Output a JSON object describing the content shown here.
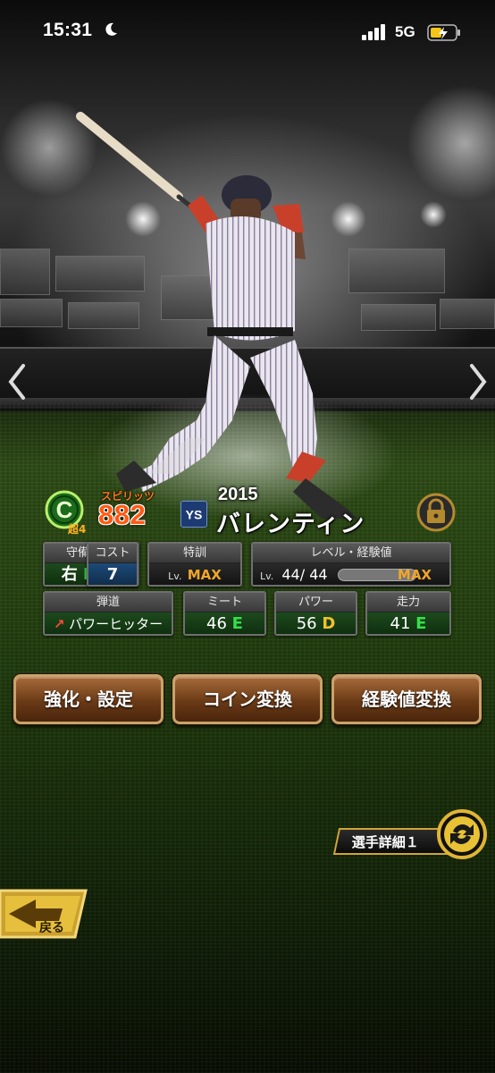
{
  "status_bar": {
    "time": "15:31",
    "network": "5G"
  },
  "player": {
    "rank": "超4",
    "spirits_label": "スピリッツ",
    "spirits": "882",
    "year": "2015",
    "name": "バレンティン"
  },
  "stats": {
    "defense": {
      "label": "守備",
      "pos": "右",
      "grade": "E"
    },
    "cost": {
      "label": "コスト",
      "value": "7"
    },
    "training": {
      "label": "特訓",
      "lv": "Lv.",
      "value": "MAX"
    },
    "level": {
      "label": "レベル・経験値",
      "lv": "Lv.",
      "current": "44",
      "max": "44",
      "exp": "MAX"
    },
    "trajectory": {
      "label": "弾道",
      "value": "パワーヒッター"
    },
    "meet": {
      "label": "ミート",
      "value": "46",
      "grade": "E"
    },
    "power": {
      "label": "パワー",
      "value": "56",
      "grade": "D"
    },
    "speed": {
      "label": "走力",
      "value": "41",
      "grade": "E"
    }
  },
  "buttons": {
    "enhance": "強化・設定",
    "coin": "コイン変換",
    "exp": "経験値変換"
  },
  "detail_tab": "選手詳細１",
  "back_label": "戻る",
  "colors": {
    "gold": "#cfa53c",
    "button_brown": "#6a3a16",
    "grade_e": "#35e04b",
    "grade_d": "#f2c12e",
    "spirits": "#ff5a14"
  }
}
